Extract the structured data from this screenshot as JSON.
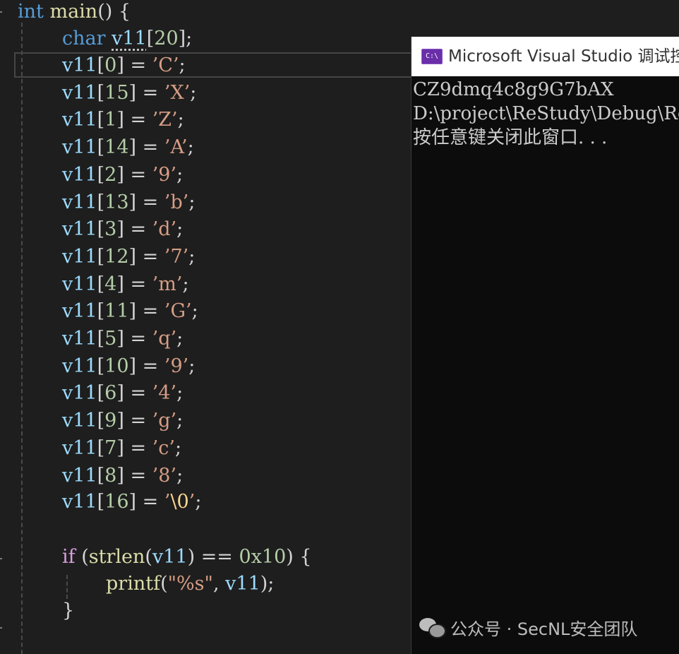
{
  "editor": {
    "header": {
      "kw": "int",
      "name": "main",
      "rest": "() {"
    },
    "decl": {
      "type": "char",
      "name": "v11",
      "size": "20"
    },
    "assignments": [
      {
        "idx": "0",
        "ch": "C"
      },
      {
        "idx": "15",
        "ch": "X"
      },
      {
        "idx": "1",
        "ch": "Z"
      },
      {
        "idx": "14",
        "ch": "A"
      },
      {
        "idx": "2",
        "ch": "9"
      },
      {
        "idx": "13",
        "ch": "b"
      },
      {
        "idx": "3",
        "ch": "d"
      },
      {
        "idx": "12",
        "ch": "7"
      },
      {
        "idx": "4",
        "ch": "m"
      },
      {
        "idx": "11",
        "ch": "G"
      },
      {
        "idx": "5",
        "ch": "q"
      },
      {
        "idx": "10",
        "ch": "9"
      },
      {
        "idx": "6",
        "ch": "4"
      },
      {
        "idx": "9",
        "ch": "g"
      },
      {
        "idx": "7",
        "ch": "c"
      },
      {
        "idx": "8",
        "ch": "8"
      }
    ],
    "terminator": {
      "idx": "16",
      "esc": "\\0"
    },
    "if_line": {
      "kw": "if",
      "fn": "strlen",
      "arg": "v11",
      "op": "==",
      "num": "0x10"
    },
    "printf_line": {
      "fn": "printf",
      "fmt": "\"%s\"",
      "arg": "v11"
    },
    "close_brace": "}"
  },
  "console": {
    "title": "Microsoft Visual Studio 调试控制台",
    "lines": [
      "CZ9dmq4c8g9G7bAX",
      "D:\\project\\ReStudy\\Debug\\ReStudy.exe",
      "按任意键关闭此窗口. . ."
    ]
  },
  "watermark": {
    "text": "公众号 · SecNL安全团队"
  }
}
